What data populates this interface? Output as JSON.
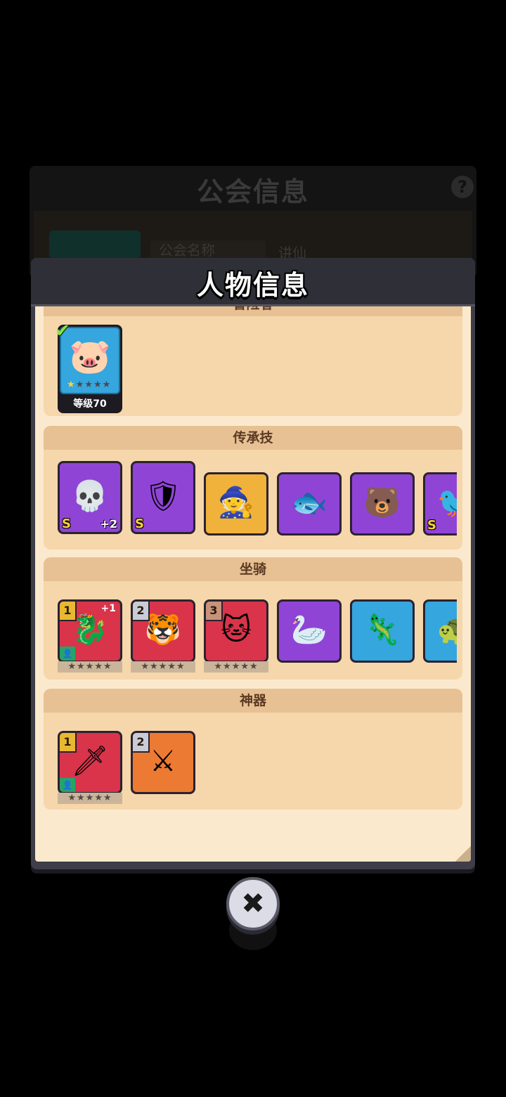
{
  "background": {
    "title": "公会信息",
    "help_glyph": "?",
    "field_label": "公会名称",
    "field_value": "讲仙"
  },
  "modal": {
    "title": "人物信息",
    "close_glyph": "✖"
  },
  "adventurer": {
    "header": "冒险者",
    "level_label": "等级70",
    "stars_filled": 1,
    "stars_total": 5,
    "icon": "pig-hero-icon"
  },
  "legacy_skills": {
    "header": "传承技",
    "items": [
      {
        "icon": "reaper-icon",
        "color": "purple",
        "grade": "S",
        "plus": "+2"
      },
      {
        "icon": "knight-icon",
        "color": "purple",
        "grade": "S",
        "plus": ""
      },
      {
        "icon": "hooded-rogue-icon",
        "color": "gold",
        "grade": "",
        "plus": ""
      },
      {
        "icon": "fish-creature-icon",
        "color": "purple",
        "grade": "",
        "plus": ""
      },
      {
        "icon": "hooded-bear-icon",
        "color": "purple",
        "grade": "",
        "plus": ""
      },
      {
        "icon": "crow-icon",
        "color": "purple",
        "grade": "S",
        "plus": ""
      }
    ]
  },
  "mounts": {
    "header": "坐骑",
    "stars": "★★★★★",
    "items": [
      {
        "icon": "dragon-mount-icon",
        "color": "red",
        "slot": "1",
        "plus": "+1",
        "equipped": true,
        "stars": true
      },
      {
        "icon": "tiger-mount-icon",
        "color": "red",
        "slot": "2",
        "plus": "",
        "equipped": false,
        "stars": true
      },
      {
        "icon": "mummy-cat-mount-icon",
        "color": "red",
        "slot": "3",
        "plus": "",
        "equipped": false,
        "stars": true
      },
      {
        "icon": "pelican-mount-icon",
        "color": "purple",
        "slot": "",
        "plus": "",
        "equipped": false,
        "stars": false
      },
      {
        "icon": "axolotl-mount-icon",
        "color": "blue",
        "slot": "",
        "plus": "",
        "equipped": false,
        "stars": false
      },
      {
        "icon": "turtle-mount-icon",
        "color": "blue",
        "slot": "",
        "plus": "",
        "equipped": false,
        "stars": false
      }
    ]
  },
  "artifacts": {
    "header": "神器",
    "stars": "★★★★★",
    "items": [
      {
        "icon": "vine-sword-icon",
        "color": "red",
        "slot": "1",
        "equipped": true,
        "stars": true
      },
      {
        "icon": "holy-sword-icon",
        "color": "orange",
        "slot": "2",
        "equipped": false,
        "stars": false
      }
    ]
  },
  "colors": {
    "paper": "#fbe9cd",
    "section": "#f6d7ab",
    "section_header": "#e7c193",
    "rarity_purple": "#8f44d6",
    "rarity_red": "#d9344a",
    "rarity_gold": "#f0b23a",
    "rarity_blue": "#35a6de",
    "rarity_orange": "#ec7a32"
  }
}
